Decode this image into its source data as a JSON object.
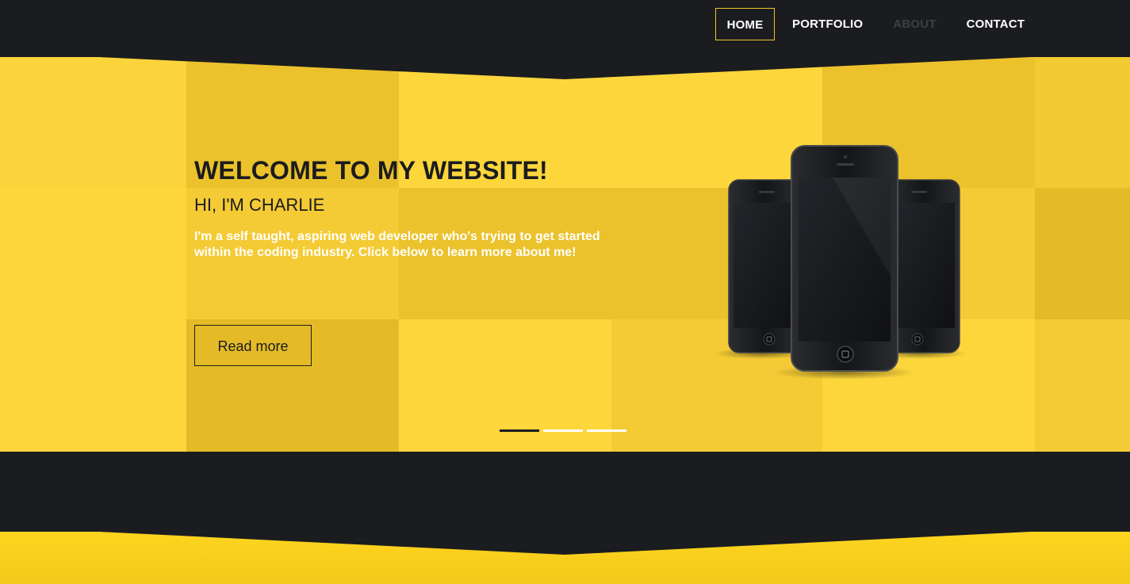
{
  "nav": {
    "items": [
      {
        "label": "HOME",
        "active": true
      },
      {
        "label": "PORTFOLIO",
        "active": false
      },
      {
        "label": "ABOUT",
        "active": false,
        "muted": true
      },
      {
        "label": "CONTACT",
        "active": false
      }
    ]
  },
  "hero": {
    "title": "WELCOME TO MY WEBSITE!",
    "subtitle": "HI, I'M CHARLIE",
    "description": "I'm a self taught, aspiring web developer who's trying to get started within the coding industry. Click below to learn more about me!",
    "button_label": "Read more",
    "image_icon": "three-smartphones-image",
    "carousel": {
      "slide_count": 3,
      "active_index": 0
    }
  },
  "colors": {
    "dark": "#1b1c1f",
    "yellow": "#fcd53b",
    "yellow_dark": "#e9c02a",
    "accent_border": "#f3c623",
    "white": "#ffffff",
    "muted_nav": "#3e3f42"
  }
}
